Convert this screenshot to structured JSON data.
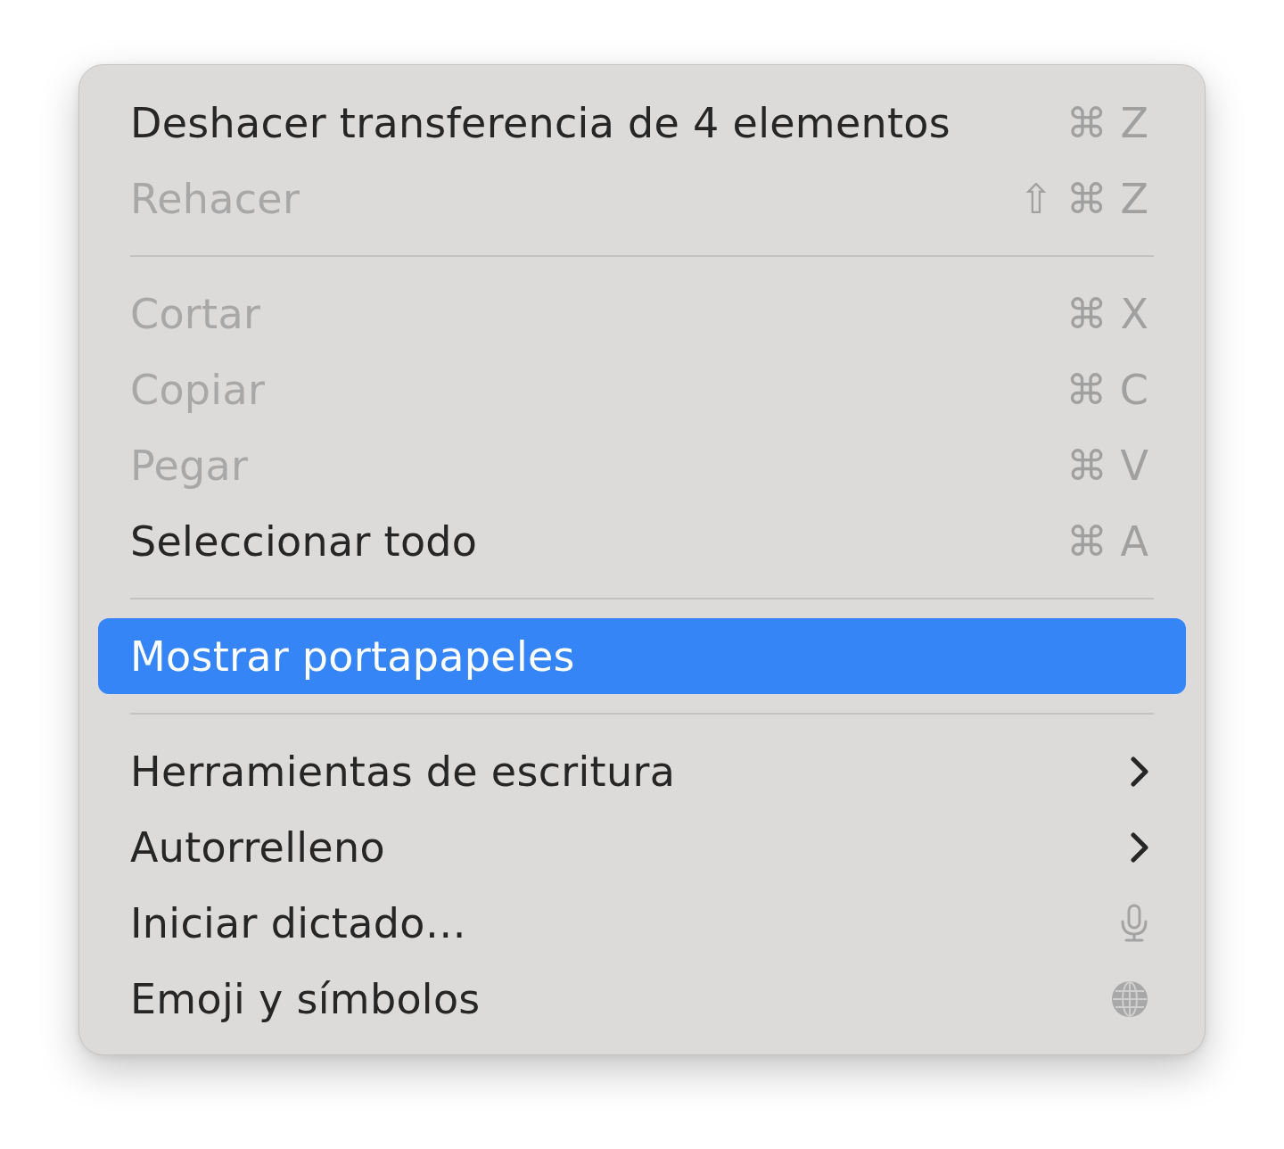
{
  "menu": {
    "groups": [
      {
        "items": [
          {
            "kind": "command",
            "label": "Deshacer transferencia de 4 elementos",
            "shortcut": "⌘ Z",
            "disabled": false,
            "selected": false
          },
          {
            "kind": "command",
            "label": "Rehacer",
            "shortcut": "⇧ ⌘ Z",
            "disabled": true,
            "selected": false
          }
        ]
      },
      {
        "items": [
          {
            "kind": "command",
            "label": "Cortar",
            "shortcut": "⌘ X",
            "disabled": true,
            "selected": false
          },
          {
            "kind": "command",
            "label": "Copiar",
            "shortcut": "⌘ C",
            "disabled": true,
            "selected": false
          },
          {
            "kind": "command",
            "label": "Pegar",
            "shortcut": "⌘ V",
            "disabled": true,
            "selected": false
          },
          {
            "kind": "command",
            "label": "Seleccionar todo",
            "shortcut": "⌘ A",
            "disabled": false,
            "selected": false
          }
        ]
      },
      {
        "items": [
          {
            "kind": "command",
            "label": "Mostrar portapapeles",
            "disabled": false,
            "selected": true
          }
        ]
      },
      {
        "items": [
          {
            "kind": "submenu",
            "label": "Herramientas de escritura",
            "disabled": false,
            "selected": false
          },
          {
            "kind": "submenu",
            "label": "Autorrelleno",
            "disabled": false,
            "selected": false
          },
          {
            "kind": "dictation",
            "label": "Iniciar dictado…",
            "disabled": false,
            "selected": false
          },
          {
            "kind": "emoji",
            "label": "Emoji y símbolos",
            "disabled": false,
            "selected": false
          }
        ]
      }
    ]
  }
}
